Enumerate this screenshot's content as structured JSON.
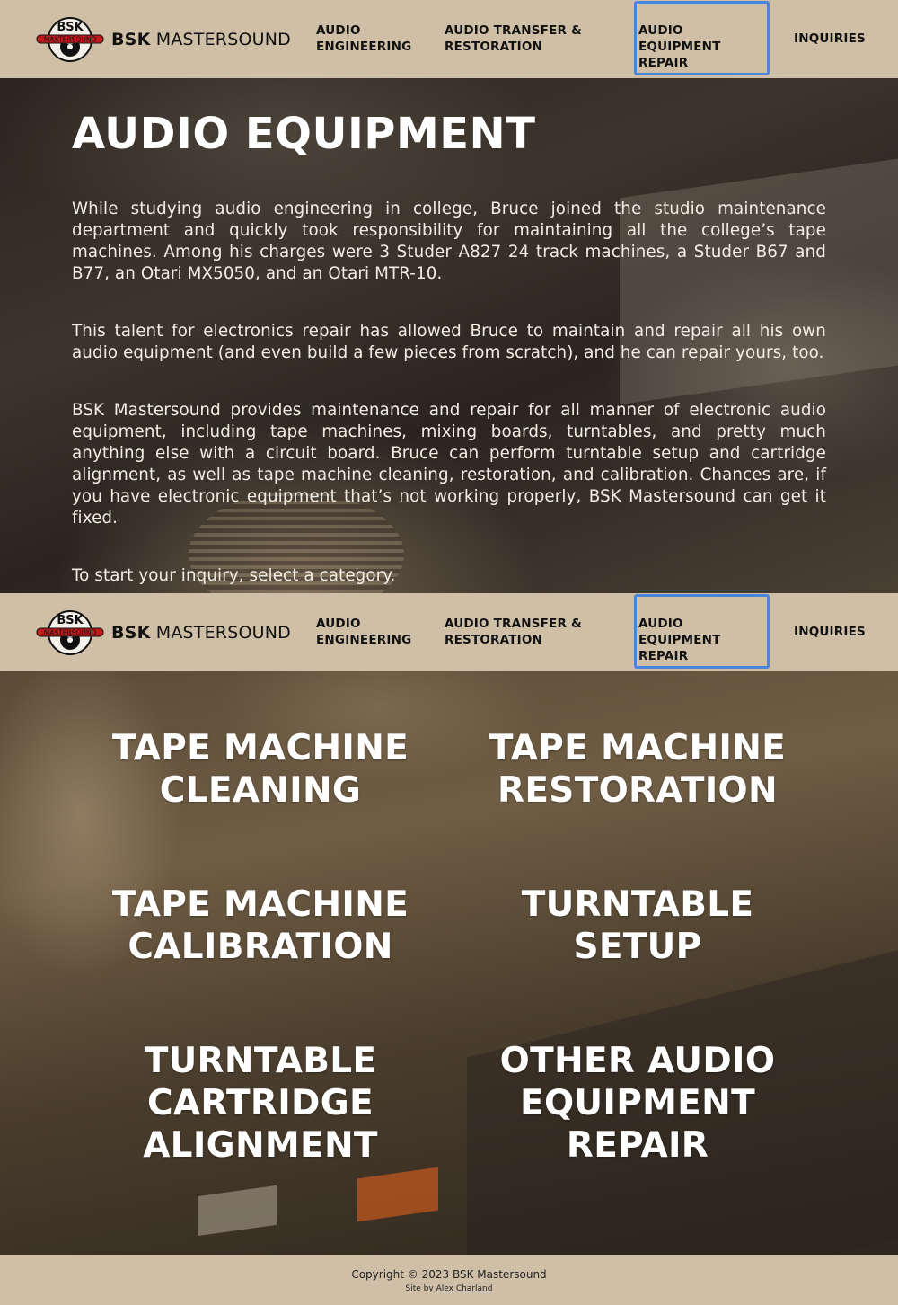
{
  "brand": {
    "name_bold": "BSK",
    "name_rest": "MASTERSOUND",
    "logo_top": "BSK",
    "logo_band": "MASTERSOUND"
  },
  "nav": {
    "audio_engineering": [
      "AUDIO",
      "ENGINEERING"
    ],
    "audio_transfer": [
      "AUDIO TRANSFER &",
      "RESTORATION"
    ],
    "audio_repair": [
      "AUDIO EQUIPMENT",
      "REPAIR"
    ],
    "inquiries": "INQUIRIES",
    "active": "audio_repair"
  },
  "hero": {
    "title": "AUDIO EQUIPMENT",
    "paragraphs": [
      "While studying audio engineering in college, Bruce joined the studio maintenance department and quickly took responsibility for maintaining all the college’s tape machines. Among his charges were 3 Studer A827 24 track machines, a Studer B67 and B77, an Otari MX5050, and an Otari MTR-10.",
      "This talent for electronics repair has allowed Bruce to maintain and repair all his own audio equipment (and even build a few pieces from scratch), and he can repair yours, too.",
      "BSK Mastersound provides maintenance and repair for all manner of electronic audio equipment, including tape machines, mixing boards, turntables, and pretty much anything else with a circuit board. Bruce can perform turntable setup and cartridge alignment, as well as tape machine cleaning, restoration, and calibration. Chances are, if you have electronic equipment that’s not working properly, BSK Mastersound can get it fixed.",
      "To start your inquiry, select a category."
    ]
  },
  "categories": [
    [
      "TAPE MACHINE",
      "CLEANING"
    ],
    [
      "TAPE MACHINE",
      "RESTORATION"
    ],
    [
      "TAPE MACHINE",
      "CALIBRATION"
    ],
    [
      "TURNTABLE",
      "SETUP"
    ],
    [
      "TURNTABLE",
      "CARTRIDGE",
      "ALIGNMENT"
    ],
    [
      "OTHER AUDIO",
      "EQUIPMENT",
      "REPAIR"
    ]
  ],
  "footer": {
    "copyright": "Copyright © 2023 BSK Mastersound",
    "credit_prefix": "Site by",
    "credit_name": "Alex Charland"
  },
  "colors": {
    "nav_bg": "#d0bfa7",
    "active_border": "#4a86d8",
    "logo_red": "#c0191c"
  }
}
